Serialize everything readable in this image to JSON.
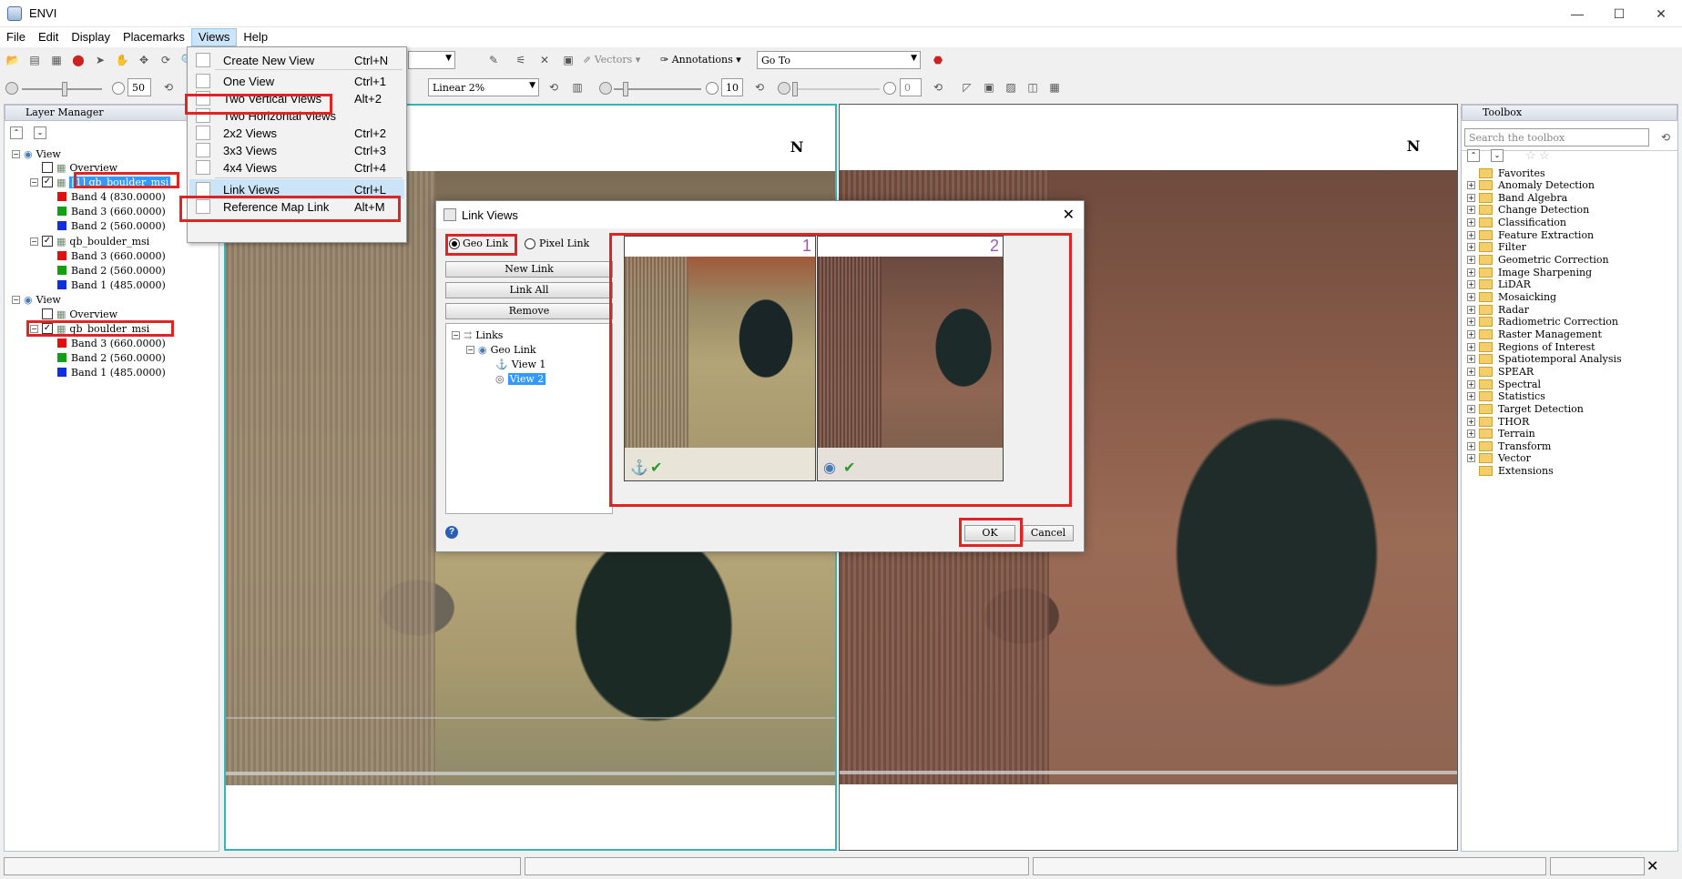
{
  "window": {
    "title": "ENVI",
    "minimize": "—",
    "maximize": "☐",
    "close": "✕"
  },
  "menu": [
    "File",
    "Edit",
    "Display",
    "Placemarks",
    "Views",
    "Help"
  ],
  "toolbar1": {
    "vectors_label": "Vectors",
    "annotations_label": "Annotations",
    "goto_placeholder": "Go To"
  },
  "toolbar2": {
    "brightness_value": "50",
    "stretch_value": "Linear 2%",
    "sharpen_value": "10",
    "transparency_value": "0"
  },
  "layer_manager": {
    "title": "Layer Manager",
    "tree": [
      {
        "label": "View",
        "level": 0
      },
      {
        "label": "Overview",
        "level": 1
      },
      {
        "label": "[1] qb_boulder_msi",
        "level": 1,
        "selected": true
      },
      {
        "label": "Band 4 (830.0000)",
        "level": 2,
        "color": "#e01010"
      },
      {
        "label": "Band 3 (660.0000)",
        "level": 2,
        "color": "#10a010"
      },
      {
        "label": "Band 2 (560.0000)",
        "level": 2,
        "color": "#1030e0"
      },
      {
        "label": "qb_boulder_msi",
        "level": 1
      },
      {
        "label": "Band 3 (660.0000)",
        "level": 2,
        "color": "#e01010"
      },
      {
        "label": "Band 2 (560.0000)",
        "level": 2,
        "color": "#10a010"
      },
      {
        "label": "Band 1 (485.0000)",
        "level": 2,
        "color": "#1030e0"
      },
      {
        "label": "View",
        "level": 0
      },
      {
        "label": "Overview",
        "level": 1
      },
      {
        "label": "qb_boulder_msi",
        "level": 1
      },
      {
        "label": "Band 3 (660.0000)",
        "level": 2,
        "color": "#e01010"
      },
      {
        "label": "Band 2 (560.0000)",
        "level": 2,
        "color": "#10a010"
      },
      {
        "label": "Band 1 (485.0000)",
        "level": 2,
        "color": "#1030e0"
      }
    ]
  },
  "views_menu": {
    "items": [
      {
        "label": "Create New View",
        "shortcut": "Ctrl+N"
      },
      {
        "label": "One View",
        "shortcut": "Ctrl+1"
      },
      {
        "label": "Two Vertical Views",
        "shortcut": "Alt+2"
      },
      {
        "label": "Two Horizontal Views",
        "shortcut": ""
      },
      {
        "label": "2x2 Views",
        "shortcut": "Ctrl+2"
      },
      {
        "label": "3x3 Views",
        "shortcut": "Ctrl+3"
      },
      {
        "label": "4x4 Views",
        "shortcut": "Ctrl+4"
      },
      {
        "label": "Link Views",
        "shortcut": "Ctrl+L"
      },
      {
        "label": "Reference Map Link",
        "shortcut": "Alt+M"
      }
    ]
  },
  "north_label": "N",
  "toolbox": {
    "title": "Toolbox",
    "search_placeholder": "Search the toolbox",
    "items": [
      "Favorites",
      "Anomaly Detection",
      "Band Algebra",
      "Change Detection",
      "Classification",
      "Feature Extraction",
      "Filter",
      "Geometric Correction",
      "Image Sharpening",
      "LiDAR",
      "Mosaicking",
      "Radar",
      "Radiometric Correction",
      "Raster Management",
      "Regions of Interest",
      "Spatiotemporal Analysis",
      "SPEAR",
      "Spectral",
      "Statistics",
      "Target Detection",
      "THOR",
      "Terrain",
      "Transform",
      "Vector",
      "Extensions"
    ]
  },
  "dialog": {
    "title": "Link Views",
    "geo_link": "Geo Link",
    "pixel_link": "Pixel Link",
    "new_link": "New Link",
    "link_all": "Link All",
    "remove": "Remove",
    "tree": {
      "root": "Links",
      "group": "Geo Link",
      "view1": "View 1",
      "view2": "View 2"
    },
    "thumb1_number": "1",
    "thumb2_number": "2",
    "ok": "OK",
    "cancel": "Cancel",
    "help": "?"
  },
  "colors": {
    "highlight_red": "#e02424",
    "view_border": "#35b5b5",
    "selection": "#3399ff",
    "thumb_number": "#9b59b6"
  }
}
